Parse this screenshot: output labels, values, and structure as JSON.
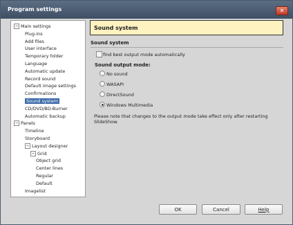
{
  "window": {
    "title": "Program settings",
    "close_glyph": "✕"
  },
  "tree": [
    {
      "label": "Main settings",
      "expander": "−"
    },
    {
      "label": "Plug-ins"
    },
    {
      "label": "Add files"
    },
    {
      "label": "User interface"
    },
    {
      "label": "Temporary folder"
    },
    {
      "label": "Language"
    },
    {
      "label": "Automatic update"
    },
    {
      "label": "Record sound"
    },
    {
      "label": "Default image settings"
    },
    {
      "label": "Confirmations"
    },
    {
      "label": "Sound system",
      "selected": true
    },
    {
      "label": "CD/DVD/BD-Burner"
    },
    {
      "label": "Automatic backup"
    },
    {
      "label": "Panels",
      "expander": "−"
    },
    {
      "label": "Timeline"
    },
    {
      "label": "Storyboard"
    },
    {
      "label": "Layout designer",
      "expander": "−"
    },
    {
      "label": "Grid",
      "expander": "−"
    },
    {
      "label": "Object grid"
    },
    {
      "label": "Center lines"
    },
    {
      "label": "Regular"
    },
    {
      "label": "Default"
    },
    {
      "label": "Imagelist"
    }
  ],
  "content": {
    "header": "Sound system",
    "section_title": "Sound system",
    "checkbox_label": "find best output mode automatically",
    "checkbox_checked": false,
    "group_title": "Sound output mode:",
    "radios": [
      {
        "label": "No sound",
        "checked": false
      },
      {
        "label": "WASAPI",
        "checked": false
      },
      {
        "label": "DirectSound",
        "checked": false
      },
      {
        "label": "Windows Multimedia",
        "checked": true
      }
    ],
    "note": "Please note that changes to the output mode take effect only after restarting SlideShow."
  },
  "buttons": {
    "ok": "OK",
    "cancel": "Cancel",
    "help": "Help"
  }
}
